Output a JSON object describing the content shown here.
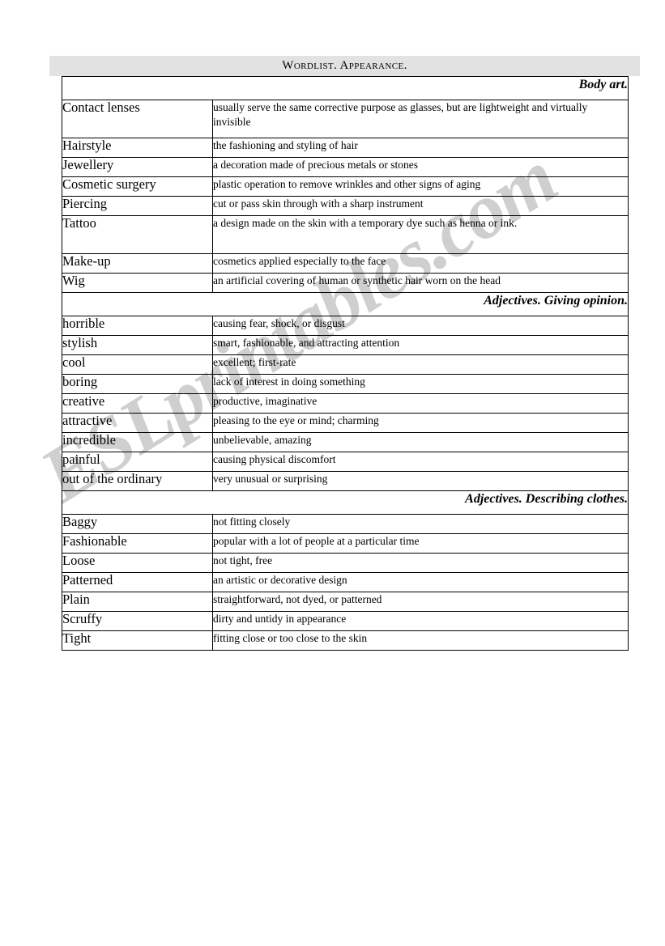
{
  "document": {
    "title": "Wordlist. Appearance.",
    "banner_title": "Wordlist. Appearance."
  },
  "watermark": {
    "text": "ESLprintables.com",
    "color": "#cdcdcd"
  },
  "colors": {
    "banner_background": "#e2e2e2",
    "table_border": "#000000",
    "text": "#000000",
    "page_background": "#ffffff"
  },
  "table": {
    "sections": [
      {
        "heading": "Body art.",
        "rows": [
          {
            "term": "Contact lenses",
            "definition": "usually serve the same corrective purpose as glasses, but are lightweight and virtually invisible",
            "tall": true
          },
          {
            "term": "Hairstyle",
            "definition": "the fashioning and styling of hair",
            "tall": false
          },
          {
            "term": "Jewellery",
            "definition": "a decoration made of precious metals or stones",
            "tall": false
          },
          {
            "term": "Cosmetic surgery",
            "definition": "plastic operation to remove wrinkles and other signs of aging",
            "tall": false
          },
          {
            "term": "Piercing",
            "definition": "cut or pass skin through with a sharp instrument",
            "tall": false
          },
          {
            "term": "Tattoo",
            "definition": "a design made on the skin with a temporary dye such as henna or ink.",
            "tall": true
          },
          {
            "term": "Make-up",
            "definition": "cosmetics applied especially to the face",
            "tall": false
          },
          {
            "term": "Wig",
            "definition": "an artificial covering of human or synthetic hair worn on the head",
            "tall": false
          }
        ]
      },
      {
        "heading": "Adjectives. Giving opinion.",
        "rows": [
          {
            "term": "horrible",
            "definition": "causing fear, shock, or disgust",
            "tall": false
          },
          {
            "term": "stylish",
            "definition": "smart, fashionable, and attracting attention",
            "tall": false
          },
          {
            "term": "cool",
            "definition": "excellent; first-rate",
            "tall": false
          },
          {
            "term": "boring",
            "definition": "lack of interest in doing something",
            "tall": false
          },
          {
            "term": "creative",
            "definition": "productive, imaginative",
            "tall": false
          },
          {
            "term": "attractive",
            "definition": "pleasing to the eye or mind; charming",
            "tall": false
          },
          {
            "term": "incredible",
            "definition": "unbelievable, amazing",
            "tall": false
          },
          {
            "term": "painful",
            "definition": "causing physical discomfort",
            "tall": false
          },
          {
            "term": "out of the ordinary",
            "definition": "very unusual or surprising",
            "tall": false
          }
        ]
      },
      {
        "heading": "Adjectives. Describing clothes.",
        "rows": [
          {
            "term": "Baggy",
            "definition": "not fitting closely",
            "tall": false
          },
          {
            "term": "Fashionable",
            "definition": "popular with a lot of people at a particular time",
            "tall": false
          },
          {
            "term": "Loose",
            "definition": "not tight, free",
            "tall": false
          },
          {
            "term": "Patterned",
            "definition": "an artistic or decorative design",
            "tall": false
          },
          {
            "term": "Plain",
            "definition": "straightforward, not dyed, or patterned",
            "tall": false
          },
          {
            "term": "Scruffy",
            "definition": "dirty and untidy in appearance",
            "tall": false
          },
          {
            "term": "Tight",
            "definition": "fitting close or too close to the skin",
            "tall": false
          }
        ]
      }
    ]
  }
}
